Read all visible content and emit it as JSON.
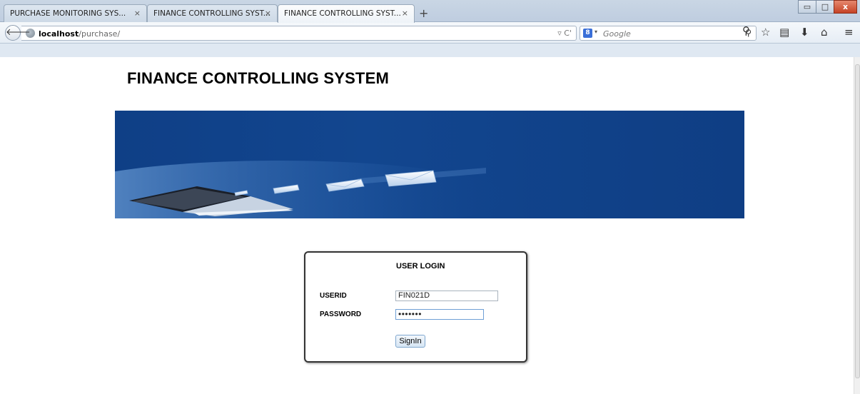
{
  "browser": {
    "tabs": [
      {
        "label": "PURCHASE MONITORING SYS...",
        "close": "×"
      },
      {
        "label": "FINANCE CONTROLLING SYST...",
        "close": "×"
      },
      {
        "label": "FINANCE CONTROLLING SYST...",
        "close": "×",
        "active": true
      }
    ],
    "new_tab": "+",
    "window_buttons": {
      "minimize": "▭",
      "maximize": "□",
      "close": "x"
    },
    "url": {
      "host": "localhost",
      "path": "/purchase/",
      "actions": "▿ C'"
    },
    "search": {
      "engine_icon": "8",
      "placeholder": "Google",
      "dropdown": "▾"
    },
    "icons": [
      "back-icon",
      "globe-icon",
      "search-icon",
      "bookmark-star-icon",
      "reading-list-icon",
      "download-icon",
      "home-icon",
      "menu-icon"
    ]
  },
  "page": {
    "title": "FINANCE CONTROLLING SYSTEM",
    "login": {
      "heading": "USER LOGIN",
      "userid_label": "USERID",
      "userid_value": "FIN021D",
      "password_label": "PASSWORD",
      "password_value": "•••••••",
      "submit_label": "SignIn"
    }
  },
  "colors": {
    "banner": "#12468f",
    "frame": "#dfe8f2"
  }
}
